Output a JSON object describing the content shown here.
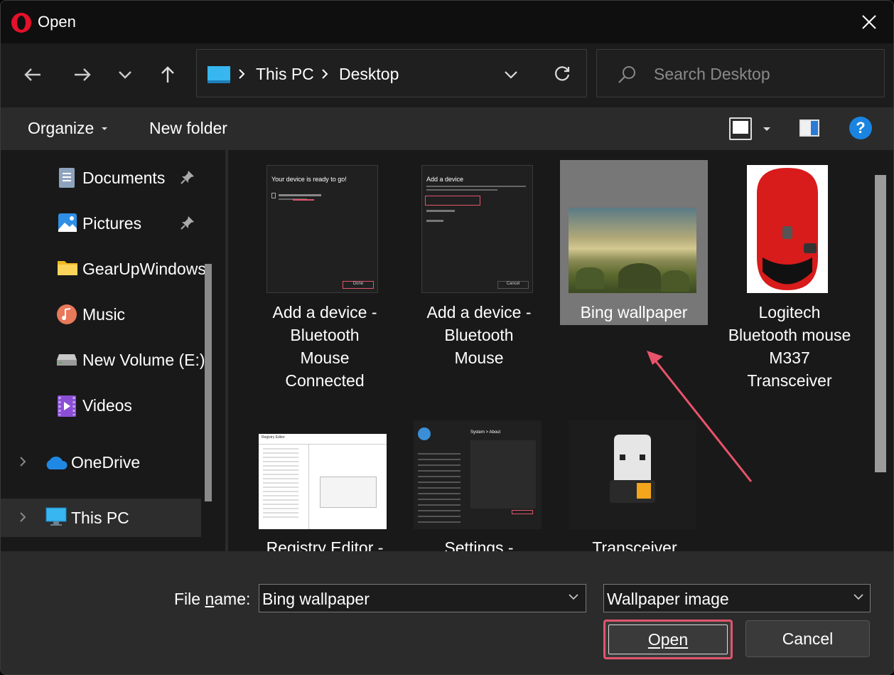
{
  "window": {
    "title": "Open",
    "colors": {
      "accent": "#1a84e0",
      "highlight": "#e0556c",
      "background": "#191919"
    }
  },
  "nav": {
    "breadcrumbs": [
      "This PC",
      "Desktop"
    ],
    "search_placeholder": "Search Desktop"
  },
  "commands": {
    "organize": "Organize",
    "new_folder": "New folder",
    "help": "?"
  },
  "sidebar": {
    "items": [
      {
        "label": "Documents",
        "icon": "documents-icon",
        "pinned": true
      },
      {
        "label": "Pictures",
        "icon": "pictures-icon",
        "pinned": true
      },
      {
        "label": "GearUpWindows",
        "icon": "folder-icon",
        "pinned": false
      },
      {
        "label": "Music",
        "icon": "music-icon",
        "pinned": false
      },
      {
        "label": "New Volume (E:)",
        "icon": "drive-icon",
        "pinned": false
      },
      {
        "label": "Videos",
        "icon": "videos-icon",
        "pinned": false
      },
      {
        "label": "OneDrive",
        "icon": "onedrive-icon",
        "pinned": false
      },
      {
        "label": "This PC",
        "icon": "pc-icon",
        "pinned": false,
        "selected": true
      }
    ]
  },
  "files": [
    {
      "name": "Add a device - Bluetooth Mouse Connected",
      "lines": [
        "Add a device -",
        "Bluetooth",
        "Mouse",
        "Connected"
      ],
      "thumb_text": "Your device is ready to go!",
      "thumb_sub": "Done"
    },
    {
      "name": "Add a device - Bluetooth Mouse",
      "lines": [
        "Add a device -",
        "Bluetooth",
        "Mouse"
      ],
      "thumb_text": "Add a device",
      "thumb_sub": "Cancel"
    },
    {
      "name": "Bing wallpaper",
      "lines": [
        "Bing wallpaper"
      ],
      "selected": true
    },
    {
      "name": "Logitech Bluetooth mouse M337 Transceiver",
      "lines": [
        "Logitech",
        "Bluetooth mouse",
        "M337",
        "Transceiver"
      ]
    },
    {
      "name": "Registry Editor -",
      "lines": [
        "Registry Editor -"
      ],
      "thumb_text": "Registry Editor"
    },
    {
      "name": "Settings -",
      "lines": [
        "Settings -"
      ],
      "thumb_text": "System > About"
    },
    {
      "name": "Transceiver",
      "lines": [
        "Transceiver"
      ]
    }
  ],
  "footer": {
    "file_name_label_pre": "File ",
    "file_name_label_u": "n",
    "file_name_label_post": "ame:",
    "file_name_value": "Bing wallpaper",
    "file_type_selected": "Wallpaper image",
    "open_label": "Open",
    "cancel_label": "Cancel"
  }
}
